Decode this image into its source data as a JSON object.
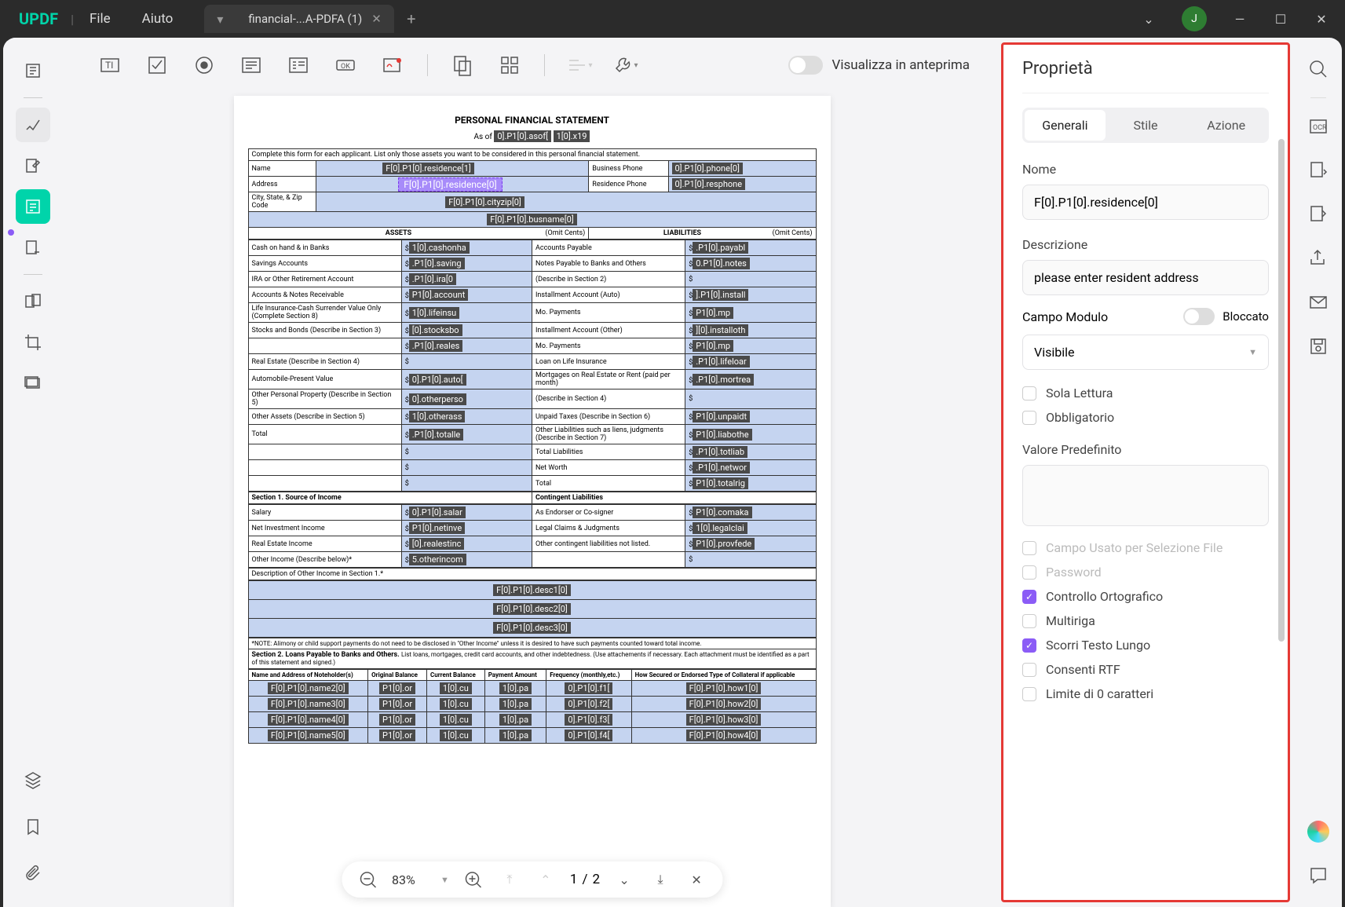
{
  "titlebar": {
    "logo": "UPDF",
    "menu_file": "File",
    "menu_help": "Aiuto",
    "tab_name": "financial-...A-PDFA (1)",
    "avatar_letter": "J"
  },
  "toolbar": {
    "preview_label": "Visualizza in anteprima"
  },
  "doc": {
    "title": "PERSONAL FINANCIAL STATEMENT",
    "asof_label": "As of",
    "asof_field": "0].P1[0].asof[",
    "x19_field": "1[0].x19",
    "instructions": "Complete this form for each applicant. List only those assets you want to be considered in this personal financial statement.",
    "labels": {
      "name": "Name",
      "busphone": "Business Phone",
      "address": "Address",
      "resphone": "Residence Phone",
      "city": "City, State, & Zip Code"
    },
    "fields": {
      "residence1": "F[0].P1[0].residence[1]",
      "phone0": "0].P1[0].phone[0]",
      "residence0": "F[0].P1[0].residence[0]",
      "resphone": "0].P1[0].resphone",
      "cityzip": "F[0].P1[0].cityzip[0]",
      "busname": "F[0].P1[0].busname[0]"
    },
    "assets_hdr": "ASSETS",
    "liab_hdr": "LIABILITIES",
    "omit": "(Omit Cents)",
    "assets": [
      {
        "l": "Cash on hand & in Banks",
        "f": "1[0].cashonha"
      },
      {
        "l": "Savings Accounts",
        "f": ".P1[0].saving"
      },
      {
        "l": "IRA or Other Retirement Account",
        "f": ".P1[0].ira[0"
      },
      {
        "l": "Accounts & Notes Receivable",
        "f": "P1[0].account"
      },
      {
        "l": "Life Insurance-Cash Surrender Value Only (Complete Section 8)",
        "f": "1[0].lifeinsu"
      },
      {
        "l": "Stocks and Bonds (Describe in Section 3)",
        "f": "[0].stocksbo"
      },
      {
        "l": "",
        "f": ".P1[0].reales"
      },
      {
        "l": "Real Estate (Describe in Section 4)",
        "f": ""
      },
      {
        "l": "Automobile-Present Value",
        "f": "0].P1[0].auto["
      },
      {
        "l": "Other Personal Property (Describe in Section 5)",
        "f": "0].otherperso"
      },
      {
        "l": "Other Assets (Describe in Section 5)",
        "f": "1[0].otherass"
      },
      {
        "l": "Total",
        "f": ".P1[0].totalle"
      }
    ],
    "liabs": [
      {
        "l": "Accounts Payable",
        "f": ".P1[0].payabl"
      },
      {
        "l": "Notes Payable to Banks and Others",
        "f": "0.P1[0].notes"
      },
      {
        "l": "(Describe in Section 2)",
        "f": ""
      },
      {
        "l": "Installment Account (Auto)",
        "f": "].P1[0].install"
      },
      {
        "l": "Mo. Payments",
        "f": "P1[0].mp"
      },
      {
        "l": "Installment Account (Other)",
        "f": "][0].installoth"
      },
      {
        "l": "Mo. Payments",
        "f": "P1[0].mp"
      },
      {
        "l": "Loan on Life Insurance",
        "f": ".P1[0].lifeloar"
      },
      {
        "l": "Mortgages on Real Estate or Rent (paid per month)",
        "f": ".P1[0].mortrea"
      },
      {
        "l": "(Describe in Section 4)",
        "f": ""
      },
      {
        "l": "Unpaid Taxes (Describe in Section 6)",
        "f": "P1[0].unpaidt"
      },
      {
        "l": "Other Liabilities such as liens, judgments (Describe in Section 7)",
        "f": "P1[0].liabothe"
      },
      {
        "l": "Total Liabilities",
        "f": ".P1[0].totliab"
      },
      {
        "l": "Net Worth",
        "f": ".P1[0].networ"
      },
      {
        "l": "Total",
        "f": "P1[0].totalrig"
      }
    ],
    "sec1": "Section 1.    Source of Income",
    "contliab": "Contingent Liabilities",
    "income": [
      {
        "l": "Salary",
        "f": "0].P1[0].salar"
      },
      {
        "l": "Net Investment Income",
        "f": "P1[0].netinve"
      },
      {
        "l": "Real Estate Income",
        "f": "[0].realestinc"
      },
      {
        "l": "Other Income (Describe below)*",
        "f": "5.otherincom"
      }
    ],
    "cont": [
      {
        "l": "As Endorser or Co-signer",
        "f": "P1[0].comaka"
      },
      {
        "l": "Legal Claims & Judgments",
        "f": "1[0].legalclai"
      },
      {
        "l": "Other contingent liabilities not listed.",
        "f": "P1[0].provfede"
      }
    ],
    "desc_hdr": "Description of Other Income in Section 1.*",
    "desc": [
      "F[0].P1[0].desc1[0]",
      "F[0].P1[0].desc2[0]",
      "F[0].P1[0].desc3[0]"
    ],
    "note": "*NOTE: Alimony or child support payments do not need to be disclosed in \"Other Income\" unless it is desired to have such payments counted toward total income.",
    "sec2": "Section 2. Loans Payable to Banks and Others.",
    "sec2_note": "List loans, mortgages, credit card accounts, and other indebtedness. (Use attachements if necessary. Each attachment must be identified as a part of this statement and signed.)",
    "loan_hdrs": [
      "Name and Address of Noteholder(s)",
      "Original Balance",
      "Current Balance",
      "Payment Amount",
      "Frequency (monthly,etc.)",
      "How Secured or Endorsed Type of Collateral if applicable"
    ],
    "loan_rows": [
      [
        "F[0].P1[0].name2[0]",
        "P1[0].or",
        "1[0].cu",
        "1[0].pa",
        "0].P1[0].f1[",
        "F[0].P1[0].how1[0]"
      ],
      [
        "F[0].P1[0].name3[0]",
        "P1[0].or",
        "1[0].cu",
        "1[0].pa",
        "0].P1[0].f2[",
        "F[0].P1[0].how2[0]"
      ],
      [
        "F[0].P1[0].name4[0]",
        "P1[0].or",
        "1[0].cu",
        "1[0].pa",
        "0].P1[0].f3[",
        "F[0].P1[0].how3[0]"
      ],
      [
        "F[0].P1[0].name5[0]",
        "P1[0].or",
        "1[0].cu",
        "1[0].pa",
        "0].P1[0].f4[",
        "F[0].P1[0].how4[0]"
      ]
    ]
  },
  "bottombar": {
    "zoom": "83%",
    "page": "1",
    "sep": "/",
    "total": "2"
  },
  "panel": {
    "title": "Proprietà",
    "tabs": [
      "Generali",
      "Stile",
      "Azione"
    ],
    "name_label": "Nome",
    "name_value": "F[0].P1[0].residence[0]",
    "desc_label": "Descrizione",
    "desc_value": "please enter resident address",
    "field_label": "Campo Modulo",
    "locked_label": "Bloccato",
    "visibility": "Visibile",
    "readonly": "Sola Lettura",
    "required": "Obbligatorio",
    "default_label": "Valore Predefinito",
    "opts": {
      "filesel": "Campo Usato per Selezione File",
      "password": "Password",
      "spellcheck": "Controllo Ortografico",
      "multiline": "Multiriga",
      "scroll": "Scorri Testo Lungo",
      "rtf": "Consenti RTF",
      "charlimit": "Limite di 0 caratteri"
    }
  }
}
